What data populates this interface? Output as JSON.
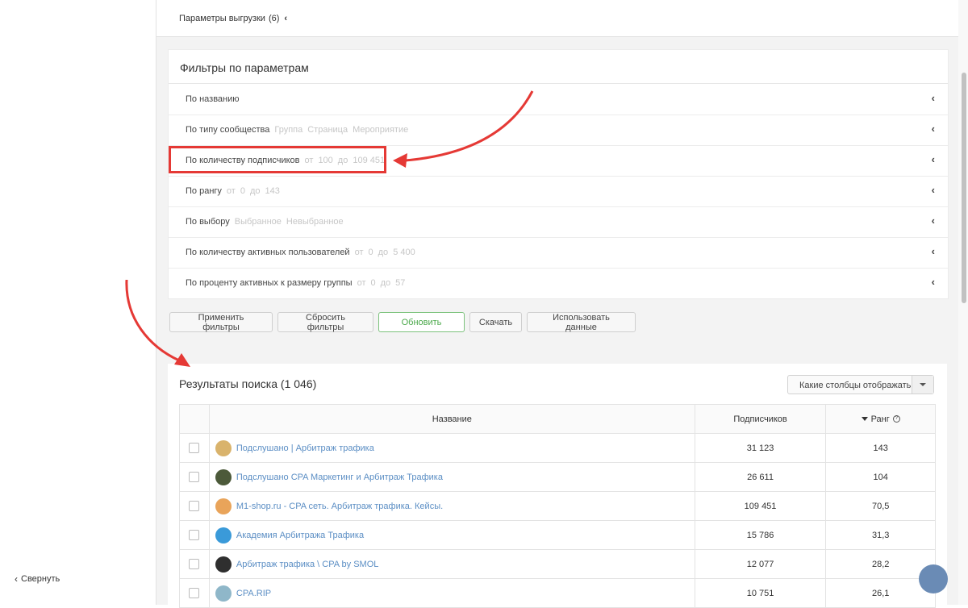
{
  "sidebar": {
    "collapse_label": "Свернуть"
  },
  "export": {
    "label": "Параметры выгрузки",
    "count": "(6)"
  },
  "filters": {
    "title": "Фильтры по параметрам",
    "rows": [
      {
        "label": "По названию",
        "hints": []
      },
      {
        "label": "По типу сообщества",
        "hints": [
          "Группа",
          "Страница",
          "Мероприятие"
        ]
      },
      {
        "label": "По количеству подписчиков",
        "hints": [
          "от",
          "100",
          "до",
          "109 451"
        ]
      },
      {
        "label": "По рангу",
        "hints": [
          "от",
          "0",
          "до",
          "143"
        ]
      },
      {
        "label": "По выбору",
        "hints": [
          "Выбранное",
          "Невыбранное"
        ]
      },
      {
        "label": "По количеству активных пользователей",
        "hints": [
          "от",
          "0",
          "до",
          "5 400"
        ]
      },
      {
        "label": "По проценту активных к размеру группы",
        "hints": [
          "от",
          "0",
          "до",
          "57"
        ]
      }
    ]
  },
  "buttons": {
    "apply": "Применить фильтры",
    "reset": "Сбросить фильтры",
    "refresh": "Обновить",
    "download": "Скачать",
    "use_data": "Использовать данные"
  },
  "results": {
    "title": "Результаты поиска (1 046)",
    "columns_select": "Какие столбцы отображать",
    "headers": {
      "name": "Название",
      "subscribers": "Подписчиков",
      "rank": "Ранг"
    },
    "rows": [
      {
        "name": "Подслушано | Арбитраж трафика",
        "subscribers": "31 123",
        "rank": "143",
        "avatar_color": "#d9b36c"
      },
      {
        "name": "Подслушано CPA Маркетинг и Арбитраж Трафика",
        "subscribers": "26 611",
        "rank": "104",
        "avatar_color": "#4c5a3a"
      },
      {
        "name": "M1-shop.ru - CPA сеть. Арбитраж трафика. Кейсы.",
        "subscribers": "109 451",
        "rank": "70,5",
        "avatar_color": "#e9a45a"
      },
      {
        "name": "Академия Арбитража Трафика",
        "subscribers": "15 786",
        "rank": "31,3",
        "avatar_color": "#3a9ad9"
      },
      {
        "name": "Арбитраж трафика \\ CPA by SMOL",
        "subscribers": "12 077",
        "rank": "28,2",
        "avatar_color": "#2f2f2f"
      },
      {
        "name": "CPA.RIP",
        "subscribers": "10 751",
        "rank": "26,1",
        "avatar_color": "#8fb7c9"
      }
    ]
  },
  "colors": {
    "accent_red": "#e53935",
    "link_blue": "#5b8ec4",
    "refresh_green": "#4aa84a",
    "fab": "#6a8bb5"
  }
}
